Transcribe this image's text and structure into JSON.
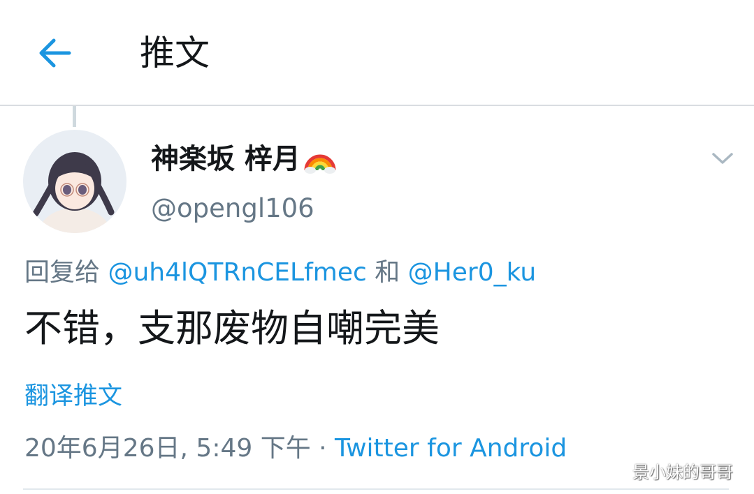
{
  "header": {
    "back_icon": "arrow-left-icon",
    "title": "推文"
  },
  "tweet": {
    "author": {
      "display_name": "神楽坂 梓月",
      "badge_icon": "rainbow-emoji",
      "handle": "@opengl106"
    },
    "more_icon": "chevron-down-icon",
    "reply_to": {
      "prefix": "回复给 ",
      "mention_1": "@uh4lQTRnCELfmec",
      "connector": " 和 ",
      "mention_2": "@Her0_ku"
    },
    "text": "不错，支那废物自嘲完美",
    "translate_label": "翻译推文",
    "timestamp": "20年6月26日, 5:49 下午",
    "separator": " · ",
    "source": "Twitter for Android"
  },
  "watermark": "景小妹的哥哥",
  "colors": {
    "accent": "#1b95e0",
    "secondary_text": "#657786",
    "primary_text": "#14171a",
    "divider": "#e1e8ed"
  }
}
